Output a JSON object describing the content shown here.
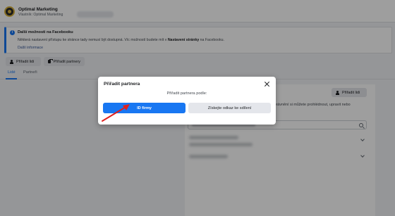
{
  "header": {
    "business_name": "Optimal Marketing",
    "owner_line": "Vlastník: Optimal Marketing"
  },
  "banner": {
    "title": "Další možnosti na Facebooku",
    "text_before": "Některá nastavení přístupu ke stránce tady nemusí být dostupná. Víc možností budete mít v ",
    "text_bold": "Nastavení stránky",
    "text_after": " na Facebooku.",
    "link": "Další informace"
  },
  "actions": {
    "assign_people": "Přiřadit lidi",
    "assign_partners": "Přiřadit partnery"
  },
  "tabs": [
    {
      "label": "Lidé",
      "active": true
    },
    {
      "label": "Partneři",
      "active": false
    }
  ],
  "background": {
    "assign_people": "Přiřadit lidi",
    "text": "h oprávnění si můžete prohlédnout, upravit nebo"
  },
  "modal": {
    "title": "Přiřadit partnera",
    "subtitle": "Přiřadit partnera podle:",
    "option_business_id": "ID firmy",
    "option_share_link": "Získejte odkaz ke sdílení"
  },
  "colors": {
    "accent": "#1877f2",
    "annotation_arrow": "#e0201e"
  }
}
